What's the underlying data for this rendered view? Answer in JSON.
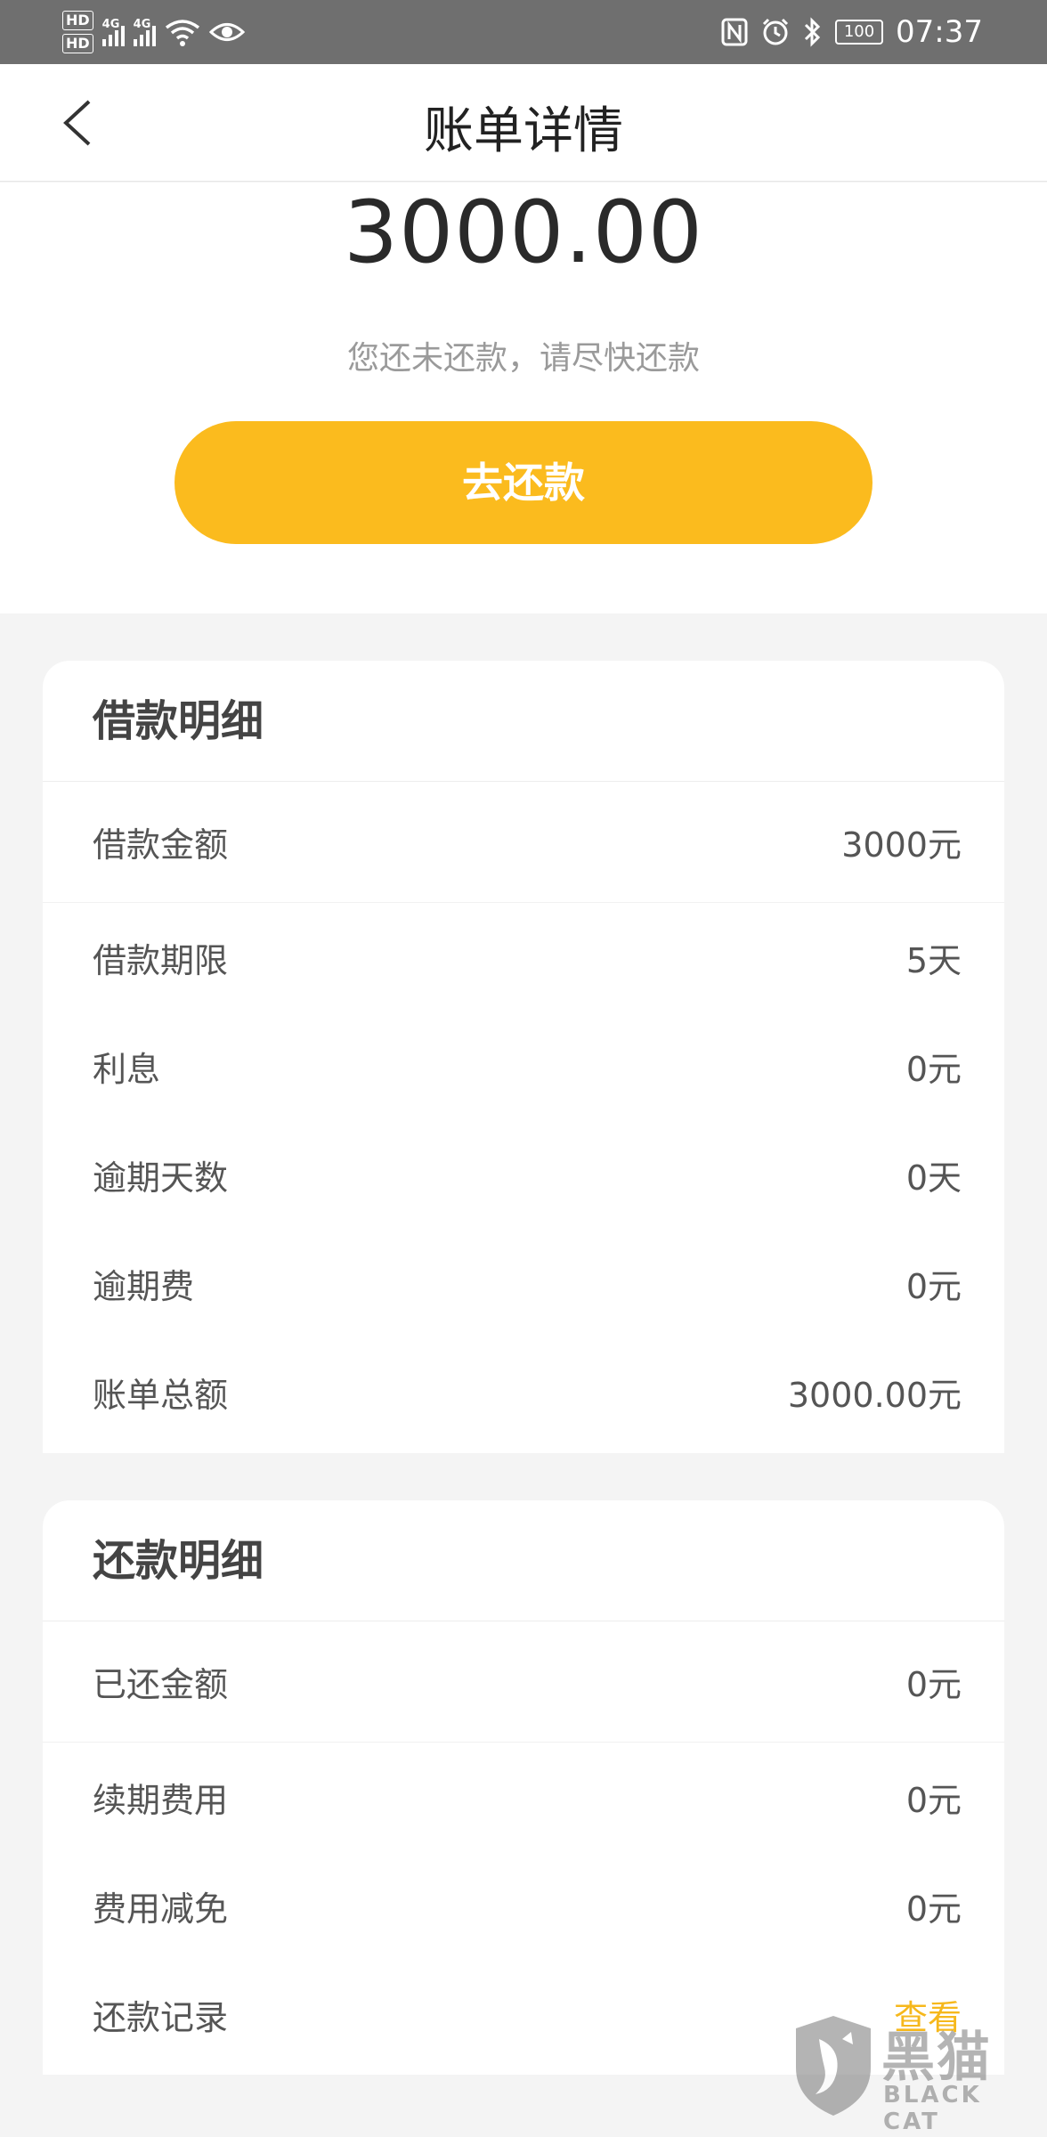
{
  "status_bar": {
    "hd1": "HD",
    "hd2": "HD",
    "sim1_label": "4G",
    "sim2_label": "4G",
    "battery": "100",
    "time": "07:37",
    "icons": [
      "nfc-icon",
      "alarm-icon",
      "bluetooth-icon",
      "wifi-icon",
      "eye-icon"
    ]
  },
  "nav": {
    "title": "账单详情",
    "back_icon": "chevron-left-icon"
  },
  "hero": {
    "amount": "3000.00",
    "hint": "您还未还款，请尽快还款",
    "pay_button": "去还款",
    "accent_color": "#fbbb1e"
  },
  "loan_details": {
    "title": "借款明细",
    "rows": [
      {
        "label": "借款金额",
        "value": "3000元"
      },
      {
        "label": "借款期限",
        "value": "5天"
      },
      {
        "label": "利息",
        "value": "0元"
      },
      {
        "label": "逾期天数",
        "value": "0天"
      },
      {
        "label": "逾期费",
        "value": "0元"
      },
      {
        "label": "账单总额",
        "value": "3000.00元"
      }
    ]
  },
  "repay_details": {
    "title": "还款明细",
    "rows": [
      {
        "label": "已还金额",
        "value": "0元"
      },
      {
        "label": "续期费用",
        "value": "0元"
      },
      {
        "label": "费用减免",
        "value": "0元"
      },
      {
        "label": "还款记录",
        "value": "查看"
      }
    ]
  },
  "watermark": {
    "text": "黑猫",
    "sub": "BLACK CAT"
  }
}
